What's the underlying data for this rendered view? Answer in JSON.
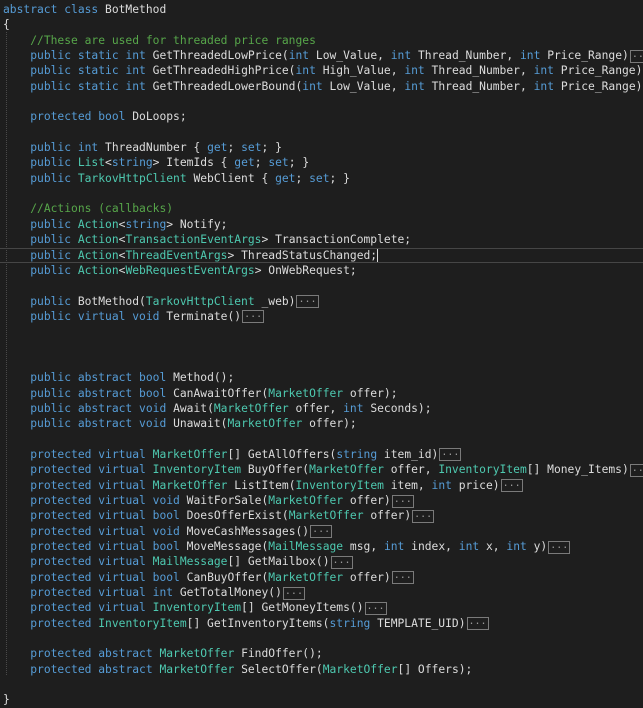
{
  "editor": {
    "lines": [
      [
        [
          "kw",
          "abstract "
        ],
        [
          "kw",
          "class "
        ],
        [
          "id",
          "BotMethod"
        ]
      ],
      [
        [
          "id",
          "{"
        ]
      ],
      [
        [
          "id",
          "    "
        ],
        [
          "cm",
          "//These are used for threaded price ranges"
        ]
      ],
      [
        [
          "id",
          "    "
        ],
        [
          "kw",
          "public "
        ],
        [
          "kw",
          "static "
        ],
        [
          "kw",
          "int "
        ],
        [
          "id",
          "GetThreadedLowPrice("
        ],
        [
          "kw",
          "int "
        ],
        [
          "id",
          "Low_Value, "
        ],
        [
          "kw",
          "int "
        ],
        [
          "id",
          "Thread_Number, "
        ],
        [
          "kw",
          "int "
        ],
        [
          "id",
          "Price_Range)"
        ],
        [
          "fold",
          "..."
        ]
      ],
      [
        [
          "id",
          "    "
        ],
        [
          "kw",
          "public "
        ],
        [
          "kw",
          "static "
        ],
        [
          "kw",
          "int "
        ],
        [
          "id",
          "GetThreadedHighPrice("
        ],
        [
          "kw",
          "int "
        ],
        [
          "id",
          "High_Value, "
        ],
        [
          "kw",
          "int "
        ],
        [
          "id",
          "Thread_Number, "
        ],
        [
          "kw",
          "int "
        ],
        [
          "id",
          "Price_Range)"
        ],
        [
          "fold",
          "..."
        ]
      ],
      [
        [
          "id",
          "    "
        ],
        [
          "kw",
          "public "
        ],
        [
          "kw",
          "static "
        ],
        [
          "kw",
          "int "
        ],
        [
          "id",
          "GetThreadedLowerBound("
        ],
        [
          "kw",
          "int "
        ],
        [
          "id",
          "Low_Value, "
        ],
        [
          "kw",
          "int "
        ],
        [
          "id",
          "Thread_Number, "
        ],
        [
          "kw",
          "int "
        ],
        [
          "id",
          "Price_Range)"
        ],
        [
          "fold",
          "..."
        ]
      ],
      [],
      [
        [
          "id",
          "    "
        ],
        [
          "kw",
          "protected "
        ],
        [
          "kw",
          "bool "
        ],
        [
          "id",
          "DoLoops;"
        ]
      ],
      [],
      [
        [
          "id",
          "    "
        ],
        [
          "kw",
          "public "
        ],
        [
          "kw",
          "int "
        ],
        [
          "id",
          "ThreadNumber { "
        ],
        [
          "kw",
          "get"
        ],
        [
          "id",
          "; "
        ],
        [
          "kw",
          "set"
        ],
        [
          "id",
          "; }"
        ]
      ],
      [
        [
          "id",
          "    "
        ],
        [
          "kw",
          "public "
        ],
        [
          "ty",
          "List"
        ],
        [
          "id",
          "<"
        ],
        [
          "kw",
          "string"
        ],
        [
          "id",
          "> ItemIds { "
        ],
        [
          "kw",
          "get"
        ],
        [
          "id",
          "; "
        ],
        [
          "kw",
          "set"
        ],
        [
          "id",
          "; }"
        ]
      ],
      [
        [
          "id",
          "    "
        ],
        [
          "kw",
          "public "
        ],
        [
          "ty",
          "TarkovHttpClient "
        ],
        [
          "id",
          "WebClient { "
        ],
        [
          "kw",
          "get"
        ],
        [
          "id",
          "; "
        ],
        [
          "kw",
          "set"
        ],
        [
          "id",
          "; }"
        ]
      ],
      [],
      [
        [
          "id",
          "    "
        ],
        [
          "cm",
          "//Actions (callbacks)"
        ]
      ],
      [
        [
          "id",
          "    "
        ],
        [
          "kw",
          "public "
        ],
        [
          "ty",
          "Action"
        ],
        [
          "id",
          "<"
        ],
        [
          "kw",
          "string"
        ],
        [
          "id",
          "> Notify;"
        ]
      ],
      [
        [
          "id",
          "    "
        ],
        [
          "kw",
          "public "
        ],
        [
          "ty",
          "Action"
        ],
        [
          "id",
          "<"
        ],
        [
          "ty",
          "TransactionEventArgs"
        ],
        [
          "id",
          "> TransactionComplete;"
        ]
      ],
      [
        [
          "id",
          "    "
        ],
        [
          "kw",
          "public "
        ],
        [
          "ty",
          "Action"
        ],
        [
          "id",
          "<"
        ],
        [
          "ty",
          "ThreadEventArgs"
        ],
        [
          "id",
          "> ThreadStatusChanged;"
        ],
        [
          "caret",
          ""
        ]
      ],
      [
        [
          "id",
          "    "
        ],
        [
          "kw",
          "public "
        ],
        [
          "ty",
          "Action"
        ],
        [
          "id",
          "<"
        ],
        [
          "ty",
          "WebRequestEventArgs"
        ],
        [
          "id",
          "> OnWebRequest;"
        ]
      ],
      [],
      [
        [
          "id",
          "    "
        ],
        [
          "kw",
          "public "
        ],
        [
          "id",
          "BotMethod("
        ],
        [
          "ty",
          "TarkovHttpClient "
        ],
        [
          "id",
          "_web)"
        ],
        [
          "fold",
          "..."
        ]
      ],
      [
        [
          "id",
          "    "
        ],
        [
          "kw",
          "public "
        ],
        [
          "kw",
          "virtual "
        ],
        [
          "kw",
          "void "
        ],
        [
          "id",
          "Terminate()"
        ],
        [
          "fold",
          "..."
        ]
      ],
      [],
      [],
      [],
      [
        [
          "id",
          "    "
        ],
        [
          "kw",
          "public "
        ],
        [
          "kw",
          "abstract "
        ],
        [
          "kw",
          "bool "
        ],
        [
          "id",
          "Method();"
        ]
      ],
      [
        [
          "id",
          "    "
        ],
        [
          "kw",
          "public "
        ],
        [
          "kw",
          "abstract "
        ],
        [
          "kw",
          "bool "
        ],
        [
          "id",
          "CanAwaitOffer("
        ],
        [
          "ty",
          "MarketOffer "
        ],
        [
          "id",
          "offer);"
        ]
      ],
      [
        [
          "id",
          "    "
        ],
        [
          "kw",
          "public "
        ],
        [
          "kw",
          "abstract "
        ],
        [
          "kw",
          "void "
        ],
        [
          "id",
          "Await("
        ],
        [
          "ty",
          "MarketOffer "
        ],
        [
          "id",
          "offer, "
        ],
        [
          "kw",
          "int "
        ],
        [
          "id",
          "Seconds);"
        ]
      ],
      [
        [
          "id",
          "    "
        ],
        [
          "kw",
          "public "
        ],
        [
          "kw",
          "abstract "
        ],
        [
          "kw",
          "void "
        ],
        [
          "id",
          "Unawait("
        ],
        [
          "ty",
          "MarketOffer "
        ],
        [
          "id",
          "offer);"
        ]
      ],
      [],
      [
        [
          "id",
          "    "
        ],
        [
          "kw",
          "protected "
        ],
        [
          "kw",
          "virtual "
        ],
        [
          "ty",
          "MarketOffer"
        ],
        [
          "id",
          "[] GetAllOffers("
        ],
        [
          "kw",
          "string "
        ],
        [
          "id",
          "item_id)"
        ],
        [
          "fold",
          "..."
        ]
      ],
      [
        [
          "id",
          "    "
        ],
        [
          "kw",
          "protected "
        ],
        [
          "kw",
          "virtual "
        ],
        [
          "ty",
          "InventoryItem "
        ],
        [
          "id",
          "BuyOffer("
        ],
        [
          "ty",
          "MarketOffer "
        ],
        [
          "id",
          "offer, "
        ],
        [
          "ty",
          "InventoryItem"
        ],
        [
          "id",
          "[] Money_Items)"
        ],
        [
          "fold",
          "..."
        ]
      ],
      [
        [
          "id",
          "    "
        ],
        [
          "kw",
          "protected "
        ],
        [
          "kw",
          "virtual "
        ],
        [
          "ty",
          "MarketOffer "
        ],
        [
          "id",
          "ListItem("
        ],
        [
          "ty",
          "InventoryItem "
        ],
        [
          "id",
          "item, "
        ],
        [
          "kw",
          "int "
        ],
        [
          "id",
          "price)"
        ],
        [
          "fold",
          "..."
        ]
      ],
      [
        [
          "id",
          "    "
        ],
        [
          "kw",
          "protected "
        ],
        [
          "kw",
          "virtual "
        ],
        [
          "kw",
          "void "
        ],
        [
          "id",
          "WaitForSale("
        ],
        [
          "ty",
          "MarketOffer "
        ],
        [
          "id",
          "offer)"
        ],
        [
          "fold",
          "..."
        ]
      ],
      [
        [
          "id",
          "    "
        ],
        [
          "kw",
          "protected "
        ],
        [
          "kw",
          "virtual "
        ],
        [
          "kw",
          "bool "
        ],
        [
          "id",
          "DoesOfferExist("
        ],
        [
          "ty",
          "MarketOffer "
        ],
        [
          "id",
          "offer)"
        ],
        [
          "fold",
          "..."
        ]
      ],
      [
        [
          "id",
          "    "
        ],
        [
          "kw",
          "protected "
        ],
        [
          "kw",
          "virtual "
        ],
        [
          "kw",
          "void "
        ],
        [
          "id",
          "MoveCashMessages()"
        ],
        [
          "fold",
          "..."
        ]
      ],
      [
        [
          "id",
          "    "
        ],
        [
          "kw",
          "protected "
        ],
        [
          "kw",
          "virtual "
        ],
        [
          "kw",
          "bool "
        ],
        [
          "id",
          "MoveMessage("
        ],
        [
          "ty",
          "MailMessage "
        ],
        [
          "id",
          "msg, "
        ],
        [
          "kw",
          "int "
        ],
        [
          "id",
          "index, "
        ],
        [
          "kw",
          "int "
        ],
        [
          "id",
          "x, "
        ],
        [
          "kw",
          "int "
        ],
        [
          "id",
          "y)"
        ],
        [
          "fold",
          "..."
        ]
      ],
      [
        [
          "id",
          "    "
        ],
        [
          "kw",
          "protected "
        ],
        [
          "kw",
          "virtual "
        ],
        [
          "ty",
          "MailMessage"
        ],
        [
          "id",
          "[] GetMailbox()"
        ],
        [
          "fold",
          "..."
        ]
      ],
      [
        [
          "id",
          "    "
        ],
        [
          "kw",
          "protected "
        ],
        [
          "kw",
          "virtual "
        ],
        [
          "kw",
          "bool "
        ],
        [
          "id",
          "CanBuyOffer("
        ],
        [
          "ty",
          "MarketOffer "
        ],
        [
          "id",
          "offer)"
        ],
        [
          "fold",
          "..."
        ]
      ],
      [
        [
          "id",
          "    "
        ],
        [
          "kw",
          "protected "
        ],
        [
          "kw",
          "virtual "
        ],
        [
          "kw",
          "int "
        ],
        [
          "id",
          "GetTotalMoney()"
        ],
        [
          "fold",
          "..."
        ]
      ],
      [
        [
          "id",
          "    "
        ],
        [
          "kw",
          "protected "
        ],
        [
          "kw",
          "virtual "
        ],
        [
          "ty",
          "InventoryItem"
        ],
        [
          "id",
          "[] GetMoneyItems()"
        ],
        [
          "fold",
          "..."
        ]
      ],
      [
        [
          "id",
          "    "
        ],
        [
          "kw",
          "protected "
        ],
        [
          "ty",
          "InventoryItem"
        ],
        [
          "id",
          "[] GetInventoryItems("
        ],
        [
          "kw",
          "string "
        ],
        [
          "id",
          "TEMPLATE_UID)"
        ],
        [
          "fold",
          "..."
        ]
      ],
      [],
      [
        [
          "id",
          "    "
        ],
        [
          "kw",
          "protected "
        ],
        [
          "kw",
          "abstract "
        ],
        [
          "ty",
          "MarketOffer "
        ],
        [
          "id",
          "FindOffer();"
        ]
      ],
      [
        [
          "id",
          "    "
        ],
        [
          "kw",
          "protected "
        ],
        [
          "kw",
          "abstract "
        ],
        [
          "ty",
          "MarketOffer "
        ],
        [
          "id",
          "SelectOffer("
        ],
        [
          "ty",
          "MarketOffer"
        ],
        [
          "id",
          "[] Offers);"
        ]
      ],
      [],
      [
        [
          "id",
          "}"
        ]
      ]
    ],
    "current_line": 16
  }
}
